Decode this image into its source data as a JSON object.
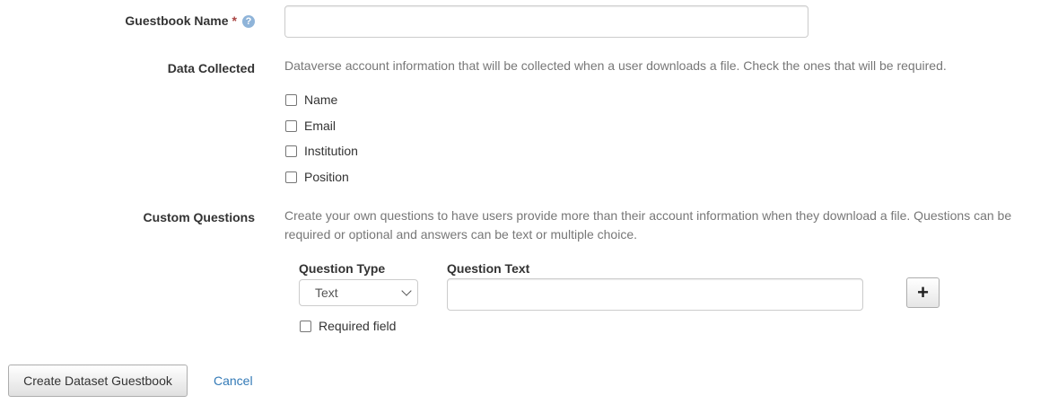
{
  "guestbook_name": {
    "label": "Guestbook Name",
    "required_mark": "*",
    "help_icon": "?",
    "value": ""
  },
  "data_collected": {
    "label": "Data Collected",
    "help": "Dataverse account information that will be collected when a user downloads a file. Check the ones that will be required.",
    "options": [
      {
        "label": "Name",
        "checked": false
      },
      {
        "label": "Email",
        "checked": false
      },
      {
        "label": "Institution",
        "checked": false
      },
      {
        "label": "Position",
        "checked": false
      }
    ]
  },
  "custom_questions": {
    "label": "Custom Questions",
    "help_line1": "Create your own questions to have users provide more than their account information when they download a file. Questions can be",
    "help_line2": "required or optional and answers can be text or multiple choice.",
    "question_type_header": "Question Type",
    "question_text_header": "Question Text",
    "question_type_selected": "Text",
    "question_text_value": "",
    "add_icon": "plus-icon",
    "required_field_label": "Required field",
    "required_field_checked": false
  },
  "actions": {
    "create_label": "Create Dataset Guestbook",
    "cancel_label": "Cancel"
  }
}
